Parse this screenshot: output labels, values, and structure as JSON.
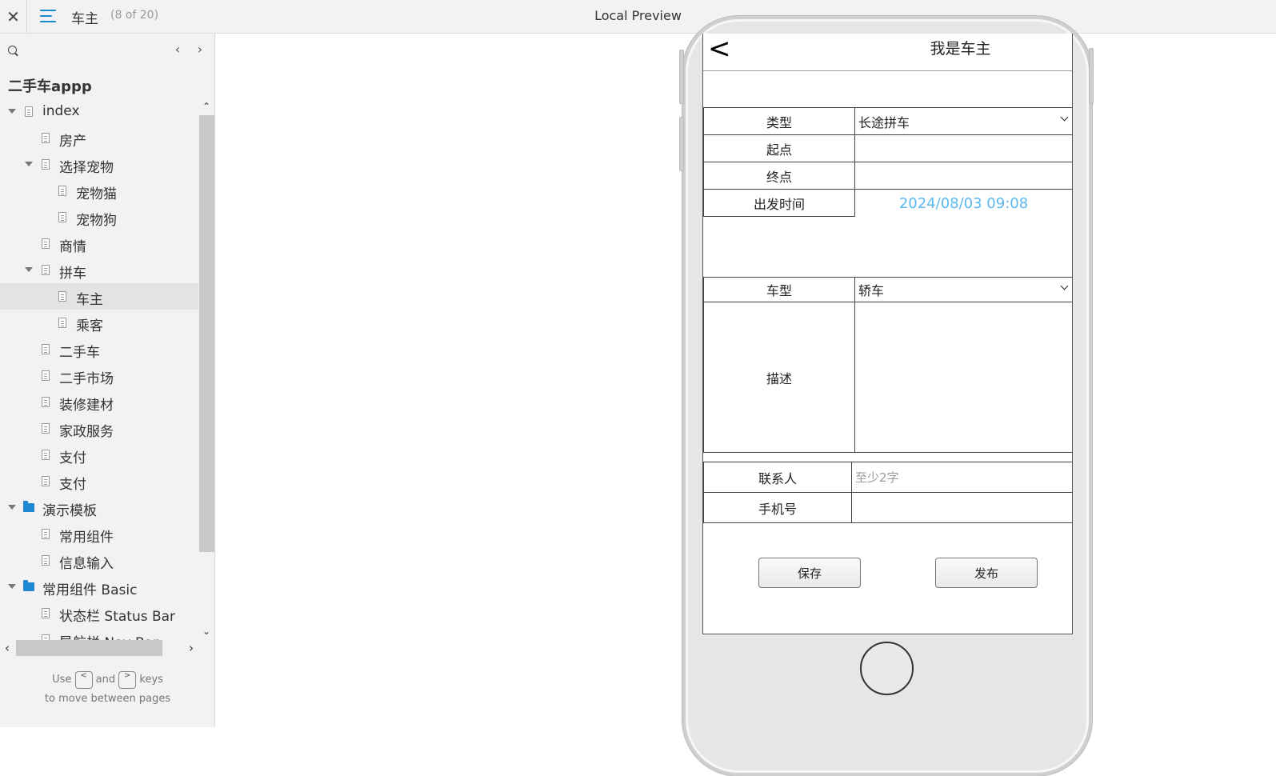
{
  "topbar": {
    "close_label": "✕",
    "page_title": "车主",
    "page_count": "(8 of 20)",
    "preview_title": "Local Preview"
  },
  "sidebar": {
    "search_placeholder": "",
    "nav_prev": "‹",
    "nav_next": "›",
    "project_title": "二手车appp",
    "items": [
      {
        "label": "index",
        "type": "page",
        "level": 0,
        "expanded": true
      },
      {
        "label": "房产",
        "type": "page",
        "level": 1
      },
      {
        "label": "选择宠物",
        "type": "page",
        "level": 1,
        "expanded": true
      },
      {
        "label": "宠物猫",
        "type": "page",
        "level": 2
      },
      {
        "label": "宠物狗",
        "type": "page",
        "level": 2
      },
      {
        "label": "商情",
        "type": "page",
        "level": 1
      },
      {
        "label": "拼车",
        "type": "page",
        "level": 1,
        "expanded": true
      },
      {
        "label": "车主",
        "type": "page",
        "level": 2,
        "selected": true
      },
      {
        "label": "乘客",
        "type": "page",
        "level": 2
      },
      {
        "label": "二手车",
        "type": "page",
        "level": 1
      },
      {
        "label": "二手市场",
        "type": "page",
        "level": 1
      },
      {
        "label": "装修建材",
        "type": "page",
        "level": 1
      },
      {
        "label": "家政服务",
        "type": "page",
        "level": 1
      },
      {
        "label": "支付",
        "type": "page",
        "level": 1
      },
      {
        "label": "支付",
        "type": "page",
        "level": 1
      },
      {
        "label": "演示模板",
        "type": "folder",
        "level": 0,
        "expanded": true
      },
      {
        "label": "常用组件",
        "type": "page",
        "level": 1
      },
      {
        "label": "信息输入",
        "type": "page",
        "level": 1
      },
      {
        "label": "常用组件 Basic",
        "type": "folder",
        "level": 0,
        "expanded": true
      },
      {
        "label": "状态栏 Status Bar",
        "type": "page",
        "level": 1
      },
      {
        "label": "导航栏 Nav Bar",
        "type": "page",
        "level": 1
      }
    ],
    "hint": {
      "use": "Use",
      "and": "and",
      "keys": "keys",
      "line2": "to move between pages",
      "key_prev": "<",
      "key_next": ">"
    }
  },
  "screen": {
    "back_label": "<",
    "title": "我是车主",
    "form": {
      "type_label": "类型",
      "type_value": "长途拼车",
      "start_label": "起点",
      "start_value": "",
      "end_label": "终点",
      "end_value": "",
      "depart_label": "出发时间",
      "depart_value": "2024/08/03 09:08",
      "car_label": "车型",
      "car_value": "轿车",
      "desc_label": "描述",
      "desc_value": "",
      "contact_label": "联系人",
      "contact_placeholder": "至少2字",
      "phone_label": "手机号",
      "phone_value": ""
    },
    "save_label": "保存",
    "publish_label": "发布"
  },
  "colors": {
    "accent": "#1e88d2",
    "date_text": "#5ab8f0",
    "sidebar_bg": "#f2f2f2",
    "selected_bg": "#e3e3e3"
  }
}
